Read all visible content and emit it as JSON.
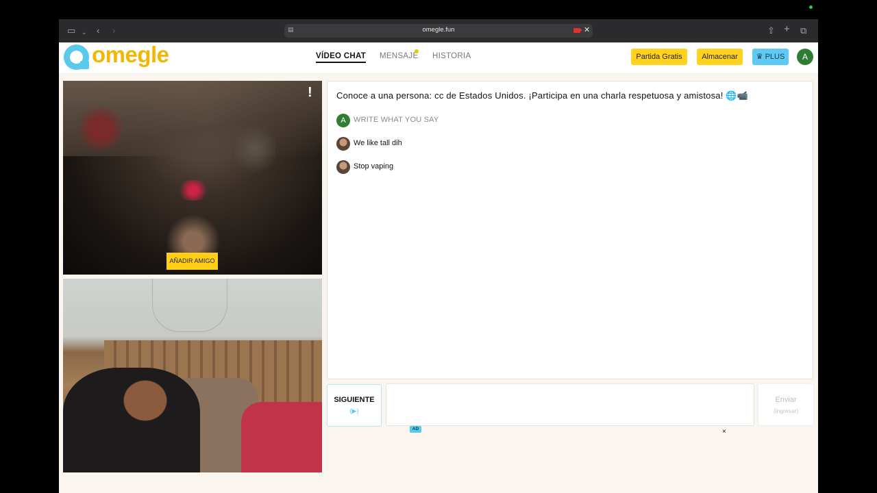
{
  "browser": {
    "url": "omegle.fun",
    "icons": [
      "sidebar-icon",
      "chevron-down-icon",
      "back-icon",
      "forward-icon",
      "page-icon",
      "camera-recording-icon",
      "close-icon",
      "share-icon",
      "new-tab-icon",
      "tabs-overview-icon"
    ]
  },
  "site": {
    "logo_text": "omegle",
    "nav": [
      {
        "label": "VÍDEO CHAT",
        "active": true
      },
      {
        "label": "MENSAJE",
        "active": false,
        "has_dot": true
      },
      {
        "label": "HISTORIA",
        "active": false
      }
    ],
    "buttons": {
      "free_match": "Partida Gratis",
      "store": "Almacenar",
      "plus": "PLUS"
    },
    "user_initial": "A",
    "colors": {
      "brand_yellow": "#f2b705",
      "brand_blue": "#5bc8ee",
      "button_yellow": "#ffd21f",
      "avatar_green": "#2e7d32"
    }
  },
  "video": {
    "remote_alert": "!",
    "add_friend": "AÑADIR AMIGO"
  },
  "chat": {
    "title": "Conoce a una persona: cc de Estados Unidos. ¡Participa en una charla respetuosa y amistosa! 🌐📹",
    "self_initial": "A",
    "prompt": "WRITE WHAT YOU SAY",
    "messages": [
      {
        "text": "We like tall dih"
      },
      {
        "text": "Stop vaping"
      }
    ]
  },
  "controls": {
    "next_label": "SIGUIENTE",
    "next_hint": "(▶)",
    "input_value": "",
    "send_label": "Enviar",
    "send_hint": "(ingresar)"
  },
  "ad": {
    "badge": "AD",
    "close": "×"
  }
}
